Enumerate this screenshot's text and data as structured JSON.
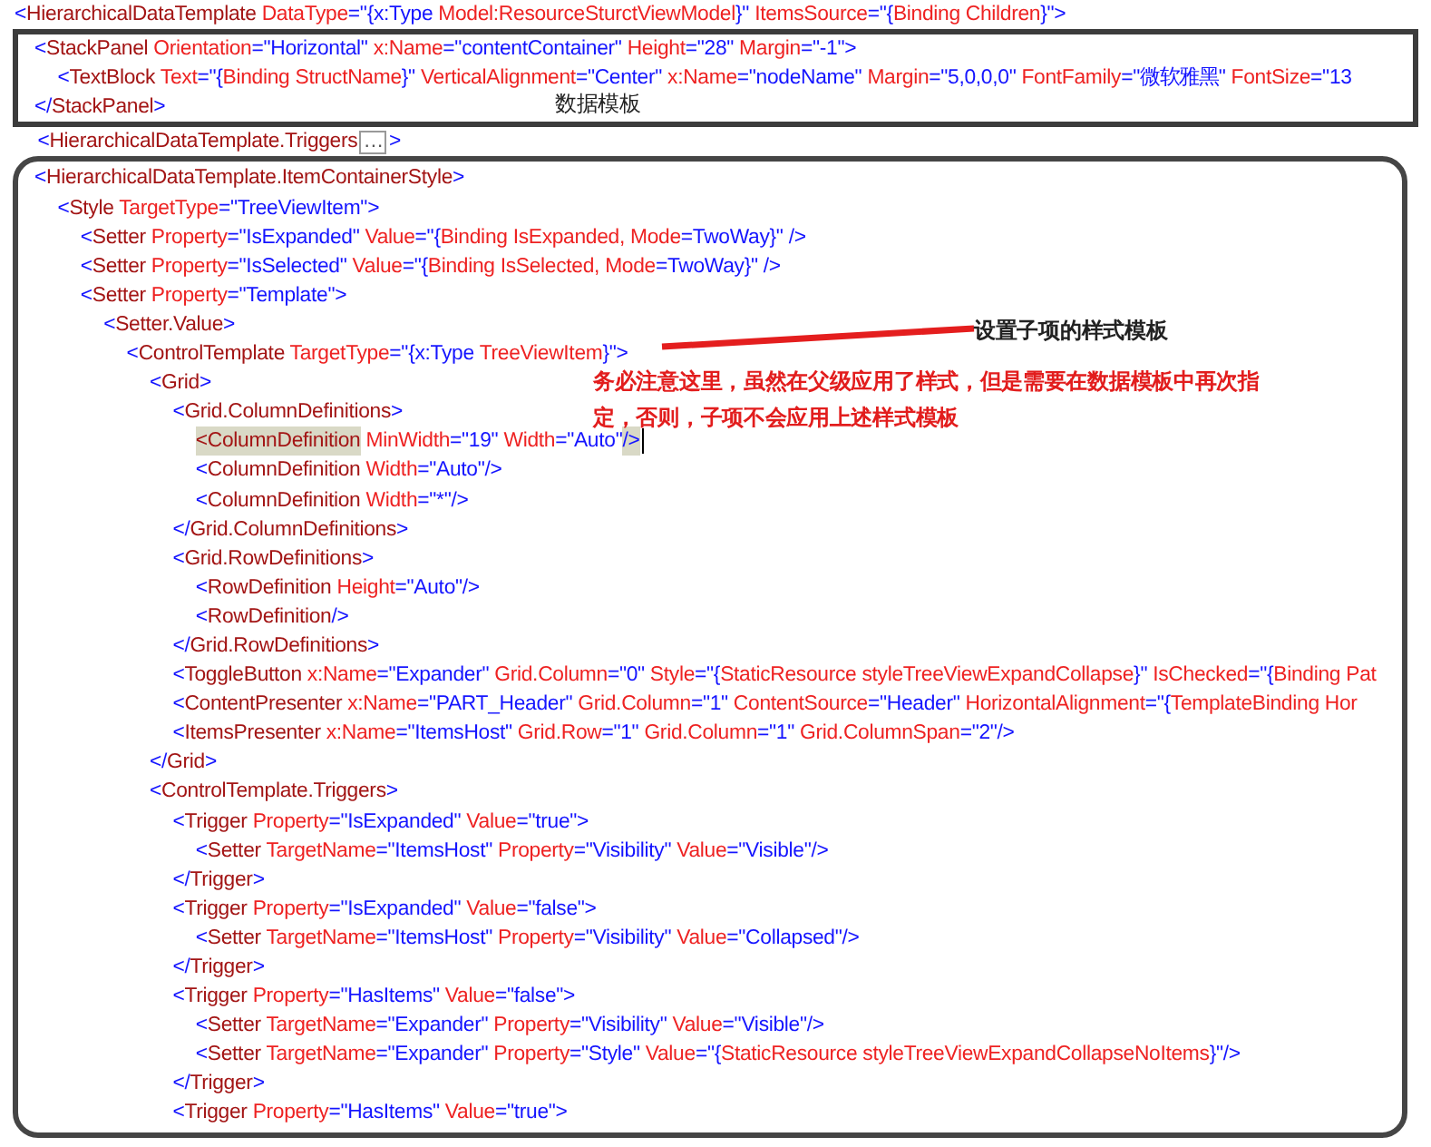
{
  "template_open": {
    "tokens": [
      {
        "kind": "b",
        "text": "<"
      },
      {
        "kind": "e",
        "text": "HierarchicalDataTemplate"
      },
      {
        "kind": "a",
        "text": " DataType"
      },
      {
        "kind": "b",
        "text": "=\"{x:Type "
      },
      {
        "kind": "a",
        "text": "Model:ResourceSturctViewModel"
      },
      {
        "kind": "b",
        "text": "}\""
      },
      {
        "kind": "a",
        "text": " ItemsSource"
      },
      {
        "kind": "b",
        "text": "=\"{"
      },
      {
        "kind": "a",
        "text": "Binding Children"
      },
      {
        "kind": "b",
        "text": "}\">"
      }
    ]
  },
  "data_template_frame": {
    "caption": "数据模板",
    "lines": [
      {
        "tokens": [
          {
            "kind": "b",
            "text": "<"
          },
          {
            "kind": "e",
            "text": "StackPanel"
          },
          {
            "kind": "a",
            "text": " Orientation"
          },
          {
            "kind": "b",
            "text": "=\"Horizontal\""
          },
          {
            "kind": "a",
            "text": " x:Name"
          },
          {
            "kind": "b",
            "text": "=\"contentContainer\""
          },
          {
            "kind": "a",
            "text": " Height"
          },
          {
            "kind": "b",
            "text": "=\"28\""
          },
          {
            "kind": "a",
            "text": " Margin"
          },
          {
            "kind": "b",
            "text": "=\"-1\">"
          }
        ],
        "children": [
          {
            "tokens": [
              {
                "kind": "b",
                "text": "<"
              },
              {
                "kind": "e",
                "text": "TextBlock"
              },
              {
                "kind": "a",
                "text": " Text"
              },
              {
                "kind": "b",
                "text": "=\"{"
              },
              {
                "kind": "a",
                "text": "Binding StructName"
              },
              {
                "kind": "b",
                "text": "}\""
              },
              {
                "kind": "a",
                "text": " VerticalAlignment"
              },
              {
                "kind": "b",
                "text": "=\"Center\""
              },
              {
                "kind": "a",
                "text": " x:Name"
              },
              {
                "kind": "b",
                "text": "=\"nodeName\""
              },
              {
                "kind": "a",
                "text": " Margin"
              },
              {
                "kind": "b",
                "text": "=\"5,0,0,0\""
              },
              {
                "kind": "a",
                "text": " FontFamily"
              },
              {
                "kind": "b",
                "text": "=\"微软雅黑\""
              },
              {
                "kind": "a",
                "text": " FontSize"
              },
              {
                "kind": "b",
                "text": "=\"13"
              }
            ]
          }
        ]
      },
      {
        "tokens": [
          {
            "kind": "b",
            "text": "</"
          },
          {
            "kind": "e",
            "text": "StackPanel"
          },
          {
            "kind": "b",
            "text": ">"
          }
        ]
      }
    ]
  },
  "triggers_line": {
    "tokens": [
      {
        "kind": "b",
        "text": "<"
      },
      {
        "kind": "e",
        "text": "HierarchicalDataTemplate.Triggers"
      },
      {
        "kind": "fold",
        "text": "…"
      },
      {
        "kind": "b",
        "text": ">"
      }
    ]
  },
  "item_container_frame": {
    "lines": [
      {
        "tokens": [
          {
            "kind": "b",
            "text": "<"
          },
          {
            "kind": "e",
            "text": "HierarchicalDataTemplate.ItemContainerStyle"
          },
          {
            "kind": "b",
            "text": ">"
          }
        ],
        "children": [
          {
            "tokens": [
              {
                "kind": "b",
                "text": "<"
              },
              {
                "kind": "e",
                "text": "Style"
              },
              {
                "kind": "a",
                "text": " TargetType"
              },
              {
                "kind": "b",
                "text": "=\"TreeViewItem\">"
              }
            ],
            "children": [
              {
                "tokens": [
                  {
                    "kind": "b",
                    "text": "<"
                  },
                  {
                    "kind": "e",
                    "text": "Setter"
                  },
                  {
                    "kind": "a",
                    "text": " Property"
                  },
                  {
                    "kind": "b",
                    "text": "=\"IsExpanded\""
                  },
                  {
                    "kind": "a",
                    "text": " Value"
                  },
                  {
                    "kind": "b",
                    "text": "=\"{"
                  },
                  {
                    "kind": "a",
                    "text": "Binding IsExpanded, Mode"
                  },
                  {
                    "kind": "b",
                    "text": "=TwoWay}\" />"
                  }
                ]
              },
              {
                "tokens": [
                  {
                    "kind": "b",
                    "text": "<"
                  },
                  {
                    "kind": "e",
                    "text": "Setter"
                  },
                  {
                    "kind": "a",
                    "text": " Property"
                  },
                  {
                    "kind": "b",
                    "text": "=\"IsSelected\""
                  },
                  {
                    "kind": "a",
                    "text": " Value"
                  },
                  {
                    "kind": "b",
                    "text": "=\"{"
                  },
                  {
                    "kind": "a",
                    "text": "Binding IsSelected, Mode"
                  },
                  {
                    "kind": "b",
                    "text": "=TwoWay}\" />"
                  }
                ]
              },
              {
                "tokens": [
                  {
                    "kind": "b",
                    "text": "<"
                  },
                  {
                    "kind": "e",
                    "text": "Setter"
                  },
                  {
                    "kind": "a",
                    "text": " Property"
                  },
                  {
                    "kind": "b",
                    "text": "=\"Template\">"
                  }
                ],
                "children": [
                  {
                    "tokens": [
                      {
                        "kind": "b",
                        "text": "<"
                      },
                      {
                        "kind": "e",
                        "text": "Setter.Value"
                      },
                      {
                        "kind": "b",
                        "text": ">"
                      }
                    ],
                    "children": [
                      {
                        "tokens": [
                          {
                            "kind": "b",
                            "text": "<"
                          },
                          {
                            "kind": "e",
                            "text": "ControlTemplate"
                          },
                          {
                            "kind": "a",
                            "text": " TargetType"
                          },
                          {
                            "kind": "b",
                            "text": "=\"{x:Type "
                          },
                          {
                            "kind": "a",
                            "text": "TreeViewItem"
                          },
                          {
                            "kind": "b",
                            "text": "}\">"
                          }
                        ],
                        "children": [
                          {
                            "tokens": [
                              {
                                "kind": "b",
                                "text": "<"
                              },
                              {
                                "kind": "e",
                                "text": "Grid"
                              },
                              {
                                "kind": "b",
                                "text": ">"
                              }
                            ],
                            "children": [
                              {
                                "tokens": [
                                  {
                                    "kind": "b",
                                    "text": "<"
                                  },
                                  {
                                    "kind": "e",
                                    "text": "Grid.ColumnDefinitions"
                                  },
                                  {
                                    "kind": "b",
                                    "text": ">"
                                  }
                                ],
                                "children": [
                                  {
                                    "tokens": [
                                      {
                                        "kind": "eh",
                                        "text": "<ColumnDefinition"
                                      },
                                      {
                                        "kind": "a",
                                        "text": " MinWidth"
                                      },
                                      {
                                        "kind": "b",
                                        "text": "=\"19\""
                                      },
                                      {
                                        "kind": "a",
                                        "text": " Width"
                                      },
                                      {
                                        "kind": "b",
                                        "text": "=\"Auto\""
                                      },
                                      {
                                        "kind": "bh",
                                        "text": "/>"
                                      },
                                      {
                                        "kind": "caret"
                                      }
                                    ]
                                  },
                                  {
                                    "tokens": [
                                      {
                                        "kind": "b",
                                        "text": "<"
                                      },
                                      {
                                        "kind": "e",
                                        "text": "ColumnDefinition"
                                      },
                                      {
                                        "kind": "a",
                                        "text": " Width"
                                      },
                                      {
                                        "kind": "b",
                                        "text": "=\"Auto\"/>"
                                      }
                                    ]
                                  },
                                  {
                                    "tokens": [
                                      {
                                        "kind": "b",
                                        "text": "<"
                                      },
                                      {
                                        "kind": "e",
                                        "text": "ColumnDefinition"
                                      },
                                      {
                                        "kind": "a",
                                        "text": " Width"
                                      },
                                      {
                                        "kind": "b",
                                        "text": "=\"*\"/>"
                                      }
                                    ]
                                  }
                                ]
                              },
                              {
                                "tokens": [
                                  {
                                    "kind": "b",
                                    "text": "</"
                                  },
                                  {
                                    "kind": "e",
                                    "text": "Grid.ColumnDefinitions"
                                  },
                                  {
                                    "kind": "b",
                                    "text": ">"
                                  }
                                ]
                              },
                              {
                                "tokens": [
                                  {
                                    "kind": "b",
                                    "text": "<"
                                  },
                                  {
                                    "kind": "e",
                                    "text": "Grid.RowDefinitions"
                                  },
                                  {
                                    "kind": "b",
                                    "text": ">"
                                  }
                                ],
                                "children": [
                                  {
                                    "tokens": [
                                      {
                                        "kind": "b",
                                        "text": "<"
                                      },
                                      {
                                        "kind": "e",
                                        "text": "RowDefinition"
                                      },
                                      {
                                        "kind": "a",
                                        "text": " Height"
                                      },
                                      {
                                        "kind": "b",
                                        "text": "=\"Auto\"/>"
                                      }
                                    ]
                                  },
                                  {
                                    "tokens": [
                                      {
                                        "kind": "b",
                                        "text": "<"
                                      },
                                      {
                                        "kind": "e",
                                        "text": "RowDefinition"
                                      },
                                      {
                                        "kind": "b",
                                        "text": "/>"
                                      }
                                    ]
                                  }
                                ]
                              },
                              {
                                "tokens": [
                                  {
                                    "kind": "b",
                                    "text": "</"
                                  },
                                  {
                                    "kind": "e",
                                    "text": "Grid.RowDefinitions"
                                  },
                                  {
                                    "kind": "b",
                                    "text": ">"
                                  }
                                ]
                              },
                              {
                                "tokens": [
                                  {
                                    "kind": "b",
                                    "text": "<"
                                  },
                                  {
                                    "kind": "e",
                                    "text": "ToggleButton"
                                  },
                                  {
                                    "kind": "a",
                                    "text": " x:Name"
                                  },
                                  {
                                    "kind": "b",
                                    "text": "=\"Expander\""
                                  },
                                  {
                                    "kind": "a",
                                    "text": " Grid.Column"
                                  },
                                  {
                                    "kind": "b",
                                    "text": "=\"0\""
                                  },
                                  {
                                    "kind": "a",
                                    "text": " Style"
                                  },
                                  {
                                    "kind": "b",
                                    "text": "=\"{"
                                  },
                                  {
                                    "kind": "a",
                                    "text": "StaticResource styleTreeViewExpandCollapse"
                                  },
                                  {
                                    "kind": "b",
                                    "text": "}\""
                                  },
                                  {
                                    "kind": "a",
                                    "text": " IsChecked"
                                  },
                                  {
                                    "kind": "b",
                                    "text": "=\"{"
                                  },
                                  {
                                    "kind": "a",
                                    "text": "Binding Pat"
                                  }
                                ]
                              },
                              {
                                "tokens": [
                                  {
                                    "kind": "b",
                                    "text": "<"
                                  },
                                  {
                                    "kind": "e",
                                    "text": "ContentPresenter"
                                  },
                                  {
                                    "kind": "a",
                                    "text": " x:Name"
                                  },
                                  {
                                    "kind": "b",
                                    "text": "=\"PART_Header\""
                                  },
                                  {
                                    "kind": "a",
                                    "text": " Grid.Column"
                                  },
                                  {
                                    "kind": "b",
                                    "text": "=\"1\""
                                  },
                                  {
                                    "kind": "a",
                                    "text": " ContentSource"
                                  },
                                  {
                                    "kind": "b",
                                    "text": "=\"Header\""
                                  },
                                  {
                                    "kind": "a",
                                    "text": " HorizontalAlignment"
                                  },
                                  {
                                    "kind": "b",
                                    "text": "=\"{"
                                  },
                                  {
                                    "kind": "a",
                                    "text": "TemplateBinding Hor"
                                  }
                                ]
                              },
                              {
                                "tokens": [
                                  {
                                    "kind": "b",
                                    "text": "<"
                                  },
                                  {
                                    "kind": "e",
                                    "text": "ItemsPresenter"
                                  },
                                  {
                                    "kind": "a",
                                    "text": " x:Name"
                                  },
                                  {
                                    "kind": "b",
                                    "text": "=\"ItemsHost\""
                                  },
                                  {
                                    "kind": "a",
                                    "text": " Grid.Row"
                                  },
                                  {
                                    "kind": "b",
                                    "text": "=\"1\""
                                  },
                                  {
                                    "kind": "a",
                                    "text": " Grid.Column"
                                  },
                                  {
                                    "kind": "b",
                                    "text": "=\"1\""
                                  },
                                  {
                                    "kind": "a",
                                    "text": " Grid.ColumnSpan"
                                  },
                                  {
                                    "kind": "b",
                                    "text": "=\"2\"/>"
                                  }
                                ]
                              }
                            ]
                          },
                          {
                            "tokens": [
                              {
                                "kind": "b",
                                "text": "</"
                              },
                              {
                                "kind": "e",
                                "text": "Grid"
                              },
                              {
                                "kind": "b",
                                "text": ">"
                              }
                            ]
                          },
                          {
                            "tokens": [
                              {
                                "kind": "b",
                                "text": "<"
                              },
                              {
                                "kind": "e",
                                "text": "ControlTemplate.Triggers"
                              },
                              {
                                "kind": "b",
                                "text": ">"
                              }
                            ],
                            "children": [
                              {
                                "tokens": [
                                  {
                                    "kind": "b",
                                    "text": "<"
                                  },
                                  {
                                    "kind": "e",
                                    "text": "Trigger"
                                  },
                                  {
                                    "kind": "a",
                                    "text": " Property"
                                  },
                                  {
                                    "kind": "b",
                                    "text": "=\"IsExpanded\""
                                  },
                                  {
                                    "kind": "a",
                                    "text": " Value"
                                  },
                                  {
                                    "kind": "b",
                                    "text": "=\"true\">"
                                  }
                                ],
                                "children": [
                                  {
                                    "tokens": [
                                      {
                                        "kind": "b",
                                        "text": "<"
                                      },
                                      {
                                        "kind": "e",
                                        "text": "Setter"
                                      },
                                      {
                                        "kind": "a",
                                        "text": " TargetName"
                                      },
                                      {
                                        "kind": "b",
                                        "text": "=\"ItemsHost\""
                                      },
                                      {
                                        "kind": "a",
                                        "text": " Property"
                                      },
                                      {
                                        "kind": "b",
                                        "text": "=\"Visibility\""
                                      },
                                      {
                                        "kind": "a",
                                        "text": " Value"
                                      },
                                      {
                                        "kind": "b",
                                        "text": "=\"Visible\"/>"
                                      }
                                    ]
                                  }
                                ]
                              },
                              {
                                "tokens": [
                                  {
                                    "kind": "b",
                                    "text": "</"
                                  },
                                  {
                                    "kind": "e",
                                    "text": "Trigger"
                                  },
                                  {
                                    "kind": "b",
                                    "text": ">"
                                  }
                                ]
                              },
                              {
                                "tokens": [
                                  {
                                    "kind": "b",
                                    "text": "<"
                                  },
                                  {
                                    "kind": "e",
                                    "text": "Trigger"
                                  },
                                  {
                                    "kind": "a",
                                    "text": " Property"
                                  },
                                  {
                                    "kind": "b",
                                    "text": "=\"IsExpanded\""
                                  },
                                  {
                                    "kind": "a",
                                    "text": " Value"
                                  },
                                  {
                                    "kind": "b",
                                    "text": "=\"false\">"
                                  }
                                ],
                                "children": [
                                  {
                                    "tokens": [
                                      {
                                        "kind": "b",
                                        "text": "<"
                                      },
                                      {
                                        "kind": "e",
                                        "text": "Setter"
                                      },
                                      {
                                        "kind": "a",
                                        "text": " TargetName"
                                      },
                                      {
                                        "kind": "b",
                                        "text": "=\"ItemsHost\""
                                      },
                                      {
                                        "kind": "a",
                                        "text": " Property"
                                      },
                                      {
                                        "kind": "b",
                                        "text": "=\"Visibility\""
                                      },
                                      {
                                        "kind": "a",
                                        "text": " Value"
                                      },
                                      {
                                        "kind": "b",
                                        "text": "=\"Collapsed\"/>"
                                      }
                                    ]
                                  }
                                ]
                              },
                              {
                                "tokens": [
                                  {
                                    "kind": "b",
                                    "text": "</"
                                  },
                                  {
                                    "kind": "e",
                                    "text": "Trigger"
                                  },
                                  {
                                    "kind": "b",
                                    "text": ">"
                                  }
                                ]
                              },
                              {
                                "tokens": [
                                  {
                                    "kind": "b",
                                    "text": "<"
                                  },
                                  {
                                    "kind": "e",
                                    "text": "Trigger"
                                  },
                                  {
                                    "kind": "a",
                                    "text": " Property"
                                  },
                                  {
                                    "kind": "b",
                                    "text": "=\"HasItems\""
                                  },
                                  {
                                    "kind": "a",
                                    "text": " Value"
                                  },
                                  {
                                    "kind": "b",
                                    "text": "=\"false\">"
                                  }
                                ],
                                "children": [
                                  {
                                    "tokens": [
                                      {
                                        "kind": "b",
                                        "text": "<"
                                      },
                                      {
                                        "kind": "e",
                                        "text": "Setter"
                                      },
                                      {
                                        "kind": "a",
                                        "text": " TargetName"
                                      },
                                      {
                                        "kind": "b",
                                        "text": "=\"Expander\""
                                      },
                                      {
                                        "kind": "a",
                                        "text": " Property"
                                      },
                                      {
                                        "kind": "b",
                                        "text": "=\"Visibility\""
                                      },
                                      {
                                        "kind": "a",
                                        "text": " Value"
                                      },
                                      {
                                        "kind": "b",
                                        "text": "=\"Visible\"/>"
                                      }
                                    ]
                                  },
                                  {
                                    "tokens": [
                                      {
                                        "kind": "b",
                                        "text": "<"
                                      },
                                      {
                                        "kind": "e",
                                        "text": "Setter"
                                      },
                                      {
                                        "kind": "a",
                                        "text": " TargetName"
                                      },
                                      {
                                        "kind": "b",
                                        "text": "=\"Expander\""
                                      },
                                      {
                                        "kind": "a",
                                        "text": " Property"
                                      },
                                      {
                                        "kind": "b",
                                        "text": "=\"Style\""
                                      },
                                      {
                                        "kind": "a",
                                        "text": " Value"
                                      },
                                      {
                                        "kind": "b",
                                        "text": "=\"{"
                                      },
                                      {
                                        "kind": "a",
                                        "text": "StaticResource styleTreeViewExpandCollapseNoItems"
                                      },
                                      {
                                        "kind": "b",
                                        "text": "}\"/>"
                                      }
                                    ]
                                  }
                                ]
                              },
                              {
                                "tokens": [
                                  {
                                    "kind": "b",
                                    "text": "</"
                                  },
                                  {
                                    "kind": "e",
                                    "text": "Trigger"
                                  },
                                  {
                                    "kind": "b",
                                    "text": ">"
                                  }
                                ]
                              },
                              {
                                "tokens": [
                                  {
                                    "kind": "b",
                                    "text": "<"
                                  },
                                  {
                                    "kind": "e",
                                    "text": "Trigger"
                                  },
                                  {
                                    "kind": "a",
                                    "text": " Property"
                                  },
                                  {
                                    "kind": "b",
                                    "text": "=\"HasItems\""
                                  },
                                  {
                                    "kind": "a",
                                    "text": " Value"
                                  },
                                  {
                                    "kind": "b",
                                    "text": "=\"true\">"
                                  }
                                ]
                              }
                            ]
                          }
                        ]
                      }
                    ]
                  }
                ]
              }
            ]
          }
        ]
      }
    ]
  },
  "annotations": {
    "callout_label": "设置子项的样式模板",
    "note_lines": [
      "务必注意这里，虽然在父级应用了样式，但是需要在数据模板中再次指",
      "定，否则，子项不会应用上述样式模板"
    ]
  }
}
